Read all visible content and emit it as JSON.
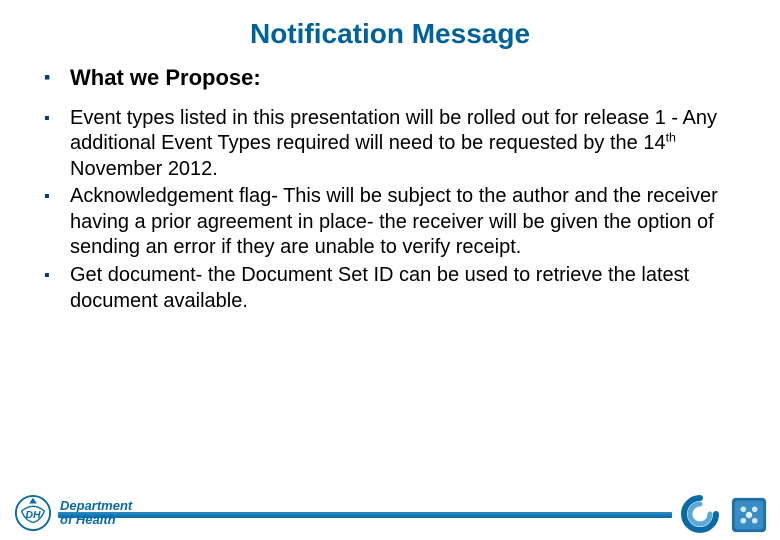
{
  "title": "Notification Message",
  "heading": "What we Propose:",
  "bullets": [
    {
      "prefix": "Event types listed in this presentation will be rolled out for release 1 - Any additional Event Types required will need to be requested by the 14",
      "sup": "th",
      "suffix": " November 2012."
    },
    {
      "prefix": "Acknowledgement flag- This will be subject to the author and the receiver having a prior agreement in place- the receiver will be given the option of sending an error if they are unable to verify receipt.",
      "sup": "",
      "suffix": ""
    },
    {
      "prefix": "Get document- the Document Set ID can be used to retrieve the latest document available.",
      "sup": "",
      "suffix": ""
    }
  ],
  "footer": {
    "dept_line1": "Department",
    "dept_line2": "of Health",
    "dh_initials": "DH"
  },
  "colors": {
    "title": "#00629b",
    "bullet": "#003b73",
    "footer_bar": "#0a6aa6"
  }
}
